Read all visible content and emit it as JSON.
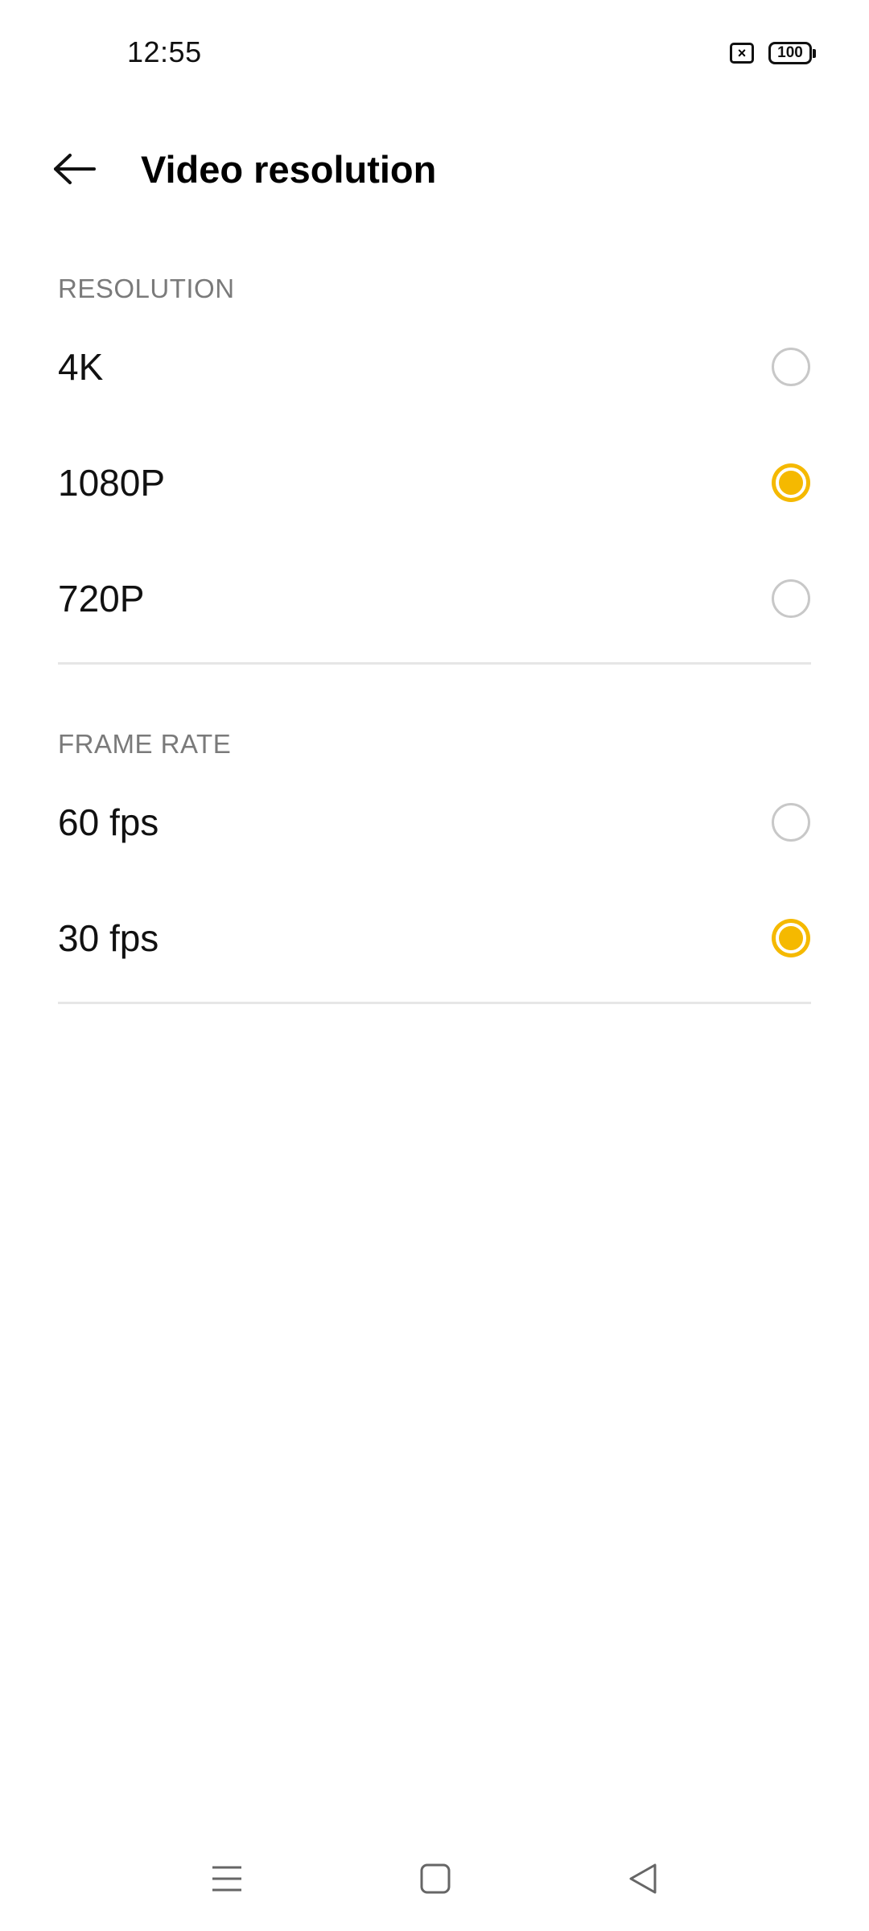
{
  "status_bar": {
    "time": "12:55",
    "sim_icon": "sim-x-icon",
    "battery_level": "100"
  },
  "header": {
    "back_icon": "arrow-left-icon",
    "title": "Video resolution"
  },
  "sections": {
    "resolution": {
      "header": "RESOLUTION",
      "options": [
        {
          "label": "4K",
          "selected": false
        },
        {
          "label": "1080P",
          "selected": true
        },
        {
          "label": "720P",
          "selected": false
        }
      ]
    },
    "frame_rate": {
      "header": "FRAME RATE",
      "options": [
        {
          "label": "60 fps",
          "selected": false
        },
        {
          "label": "30 fps",
          "selected": true
        }
      ]
    }
  },
  "colors": {
    "accent": "#F5B900",
    "radio_unselected": "#C8C8C8",
    "section_header": "#7A7A7A",
    "divider": "#E6E6E6"
  },
  "nav_bar": {
    "recents_icon": "menu-lines-icon",
    "home_icon": "square-home-icon",
    "back_icon": "triangle-back-icon"
  }
}
